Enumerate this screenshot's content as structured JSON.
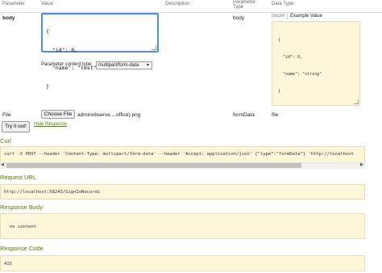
{
  "columns": {
    "parameter": "Parameter",
    "value": "Value",
    "description": "Description",
    "parameter_type_line1": "Parameter",
    "parameter_type_line2": "Type",
    "data_type": "Data Type"
  },
  "body_param": {
    "name": "body",
    "value_lines": [
      "{",
      "  \"id\": 0,",
      "  \"name\": \"test\"",
      "}"
    ],
    "content_type_label": "Parameter content type:",
    "content_type_selected": "multipart/form-data",
    "param_type": "body",
    "data_type_tabs": [
      "Model",
      "Example Value"
    ],
    "example_value_lines": [
      "{",
      "  \"id\": 0,",
      "  \"name\": \"string\"",
      "}"
    ]
  },
  "file_param": {
    "name": "File",
    "choose_button": "Choose File",
    "file_name": "adminobserve....office).png",
    "param_type": "formData",
    "data_type": "file"
  },
  "actions": {
    "try_button": "Try it out!",
    "hide_response": "Hide Response"
  },
  "curl": {
    "title": "Curl",
    "command": "curl -X POST --header 'Content-Type: multipart/form-data' --header 'Accept: application/json' {\"type\":\"formData\"} 'http://localhost"
  },
  "request_url": {
    "title": "Request URL",
    "value": "http://localhost:58243/SignInRecords"
  },
  "response_body": {
    "title": "Response Body",
    "value": "no content"
  },
  "response_code": {
    "title": "Response Code",
    "value": "415"
  }
}
